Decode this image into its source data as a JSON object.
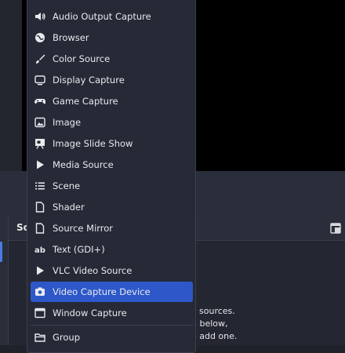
{
  "menu": {
    "items": [
      {
        "label": "Audio Output Capture",
        "icon": "speaker-icon",
        "active": false
      },
      {
        "label": "Browser",
        "icon": "globe-icon",
        "active": false
      },
      {
        "label": "Color Source",
        "icon": "brush-icon",
        "active": false
      },
      {
        "label": "Display Capture",
        "icon": "monitor-icon",
        "active": false
      },
      {
        "label": "Game Capture",
        "icon": "gamepad-icon",
        "active": false
      },
      {
        "label": "Image",
        "icon": "image-icon",
        "active": false
      },
      {
        "label": "Image Slide Show",
        "icon": "slideshow-icon",
        "active": false
      },
      {
        "label": "Media Source",
        "icon": "play-icon",
        "active": false
      },
      {
        "label": "Scene",
        "icon": "list-icon",
        "active": false
      },
      {
        "label": "Shader",
        "icon": "file-icon",
        "active": false
      },
      {
        "label": "Source Mirror",
        "icon": "file-icon",
        "active": false
      },
      {
        "label": "Text (GDI+)",
        "icon": "text-icon",
        "active": false
      },
      {
        "label": "VLC Video Source",
        "icon": "play-icon",
        "active": false
      },
      {
        "label": "Video Capture Device",
        "icon": "camera-icon",
        "active": true
      },
      {
        "label": "Window Capture",
        "icon": "window-icon",
        "active": false
      },
      {
        "label": "Group",
        "icon": "folder-icon",
        "active": false
      }
    ]
  },
  "sources_panel": {
    "title": "So",
    "hint_lines": [
      "y sources.",
      "n below,",
      "o add one."
    ]
  },
  "colors": {
    "accent": "#2e58c9",
    "menu_bg": "#262936",
    "preview_bg": "#000000"
  }
}
